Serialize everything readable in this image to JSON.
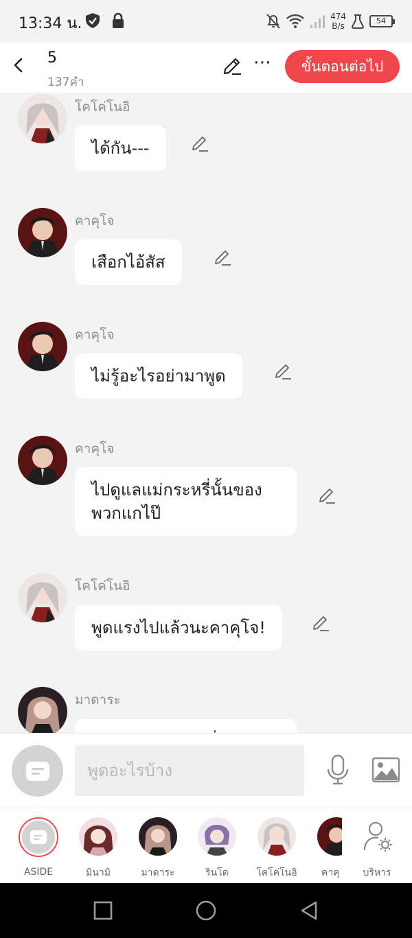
{
  "status_bar": {
    "time": "13:34 น.",
    "net_speed_value": "474",
    "net_speed_unit": "B/s",
    "battery": "54",
    "icons": [
      "shield-icon",
      "lock-icon",
      "notifications-off-icon",
      "wifi-icon",
      "signal-icon",
      "lab-icon",
      "battery-icon"
    ]
  },
  "header": {
    "title": "5",
    "word_count": "137คำ",
    "next_button": "ขั้นตอนต่อไป",
    "icons": [
      "back-icon",
      "pen-icon",
      "more-icon"
    ]
  },
  "messages": [
    {
      "speaker": "โคโค่โนอิ",
      "text": "ได้กัน---"
    },
    {
      "speaker": "คาคุโจ",
      "text": "เสือกไอ้สัส"
    },
    {
      "speaker": "คาคุโจ",
      "text": "ไม่รู้อะไรอย่ามาพูด"
    },
    {
      "speaker": "คาคุโจ",
      "text_line1": "ไปดูแลแม่กระหรี่นั้นของ",
      "text_line2": "พวกแกไป๊"
    },
    {
      "speaker": "โคโค่โนอิ",
      "text": "พูดแรงไปแล้วนะคาคุโจ!"
    },
    {
      "speaker": "มาดาระ",
      "text": "ดีลู้ะ แก่ะนะ แ-ลา่"
    }
  ],
  "input": {
    "placeholder": "พูดอะไรบ้าง",
    "icons": [
      "aside-icon",
      "microphone-icon",
      "image-icon"
    ]
  },
  "characters": [
    {
      "name": "ASIDE"
    },
    {
      "name": "มินามิ"
    },
    {
      "name": "มาดาระ"
    },
    {
      "name": "รินโด"
    },
    {
      "name": "โคโค่โนอิ"
    },
    {
      "name": "คาคุ"
    },
    {
      "name": "บริหาร"
    }
  ],
  "nav": {
    "icons": [
      "recents-icon",
      "home-icon",
      "back-triangle-icon"
    ]
  },
  "colors": {
    "accent": "#f0474c",
    "background": "#f3f3f3",
    "bubble": "#ffffff"
  }
}
